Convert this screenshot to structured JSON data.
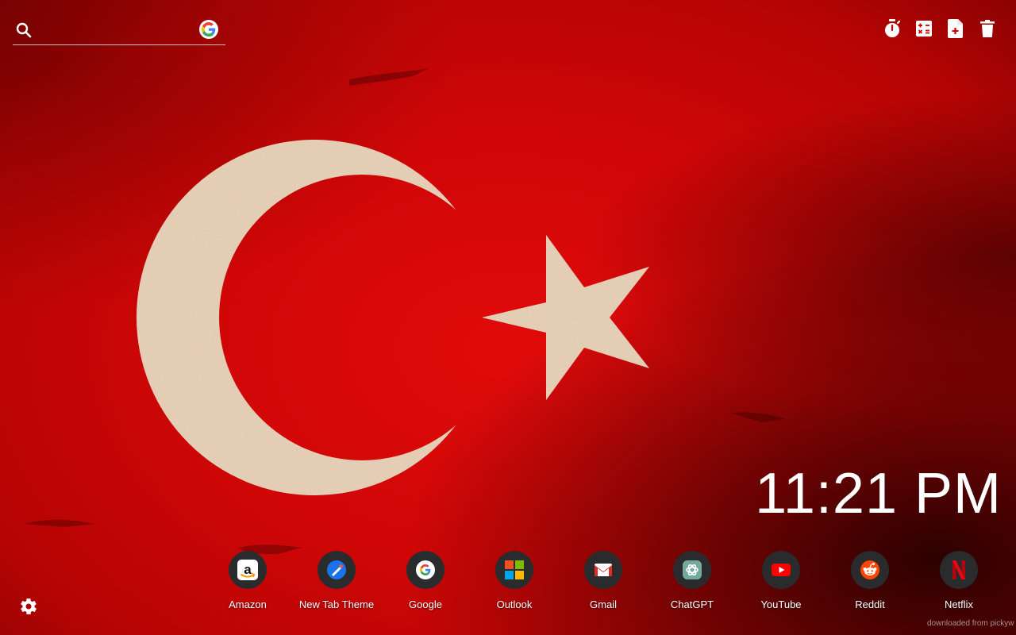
{
  "search": {
    "placeholder": "",
    "value": "",
    "engine_icon": "google-icon"
  },
  "toolbar": {
    "items": [
      {
        "name": "timer",
        "icon": "stopwatch-icon"
      },
      {
        "name": "calculator",
        "icon": "calculator-icon"
      },
      {
        "name": "new-note",
        "icon": "note-add-icon"
      },
      {
        "name": "trash",
        "icon": "trash-icon"
      }
    ]
  },
  "clock": {
    "time": "11:21 PM"
  },
  "shortcuts": [
    {
      "label": "Amazon",
      "icon": "amazon-icon"
    },
    {
      "label": "New Tab Theme",
      "icon": "new-tab-theme-icon"
    },
    {
      "label": "Google",
      "icon": "google-icon"
    },
    {
      "label": "Outlook",
      "icon": "microsoft-icon"
    },
    {
      "label": "Gmail",
      "icon": "gmail-icon"
    },
    {
      "label": "ChatGPT",
      "icon": "chatgpt-icon"
    },
    {
      "label": "YouTube",
      "icon": "youtube-icon"
    },
    {
      "label": "Reddit",
      "icon": "reddit-icon"
    },
    {
      "label": "Netflix",
      "icon": "netflix-icon"
    }
  ],
  "settings": {
    "icon": "gear-icon"
  },
  "watermark": {
    "text": "downloaded from pickyw"
  },
  "colors": {
    "flag_red": "#cf0606",
    "emblem_cream": "#efdcc6",
    "dock_icon_bg": "#2a2b2d",
    "text": "#ffffff"
  }
}
